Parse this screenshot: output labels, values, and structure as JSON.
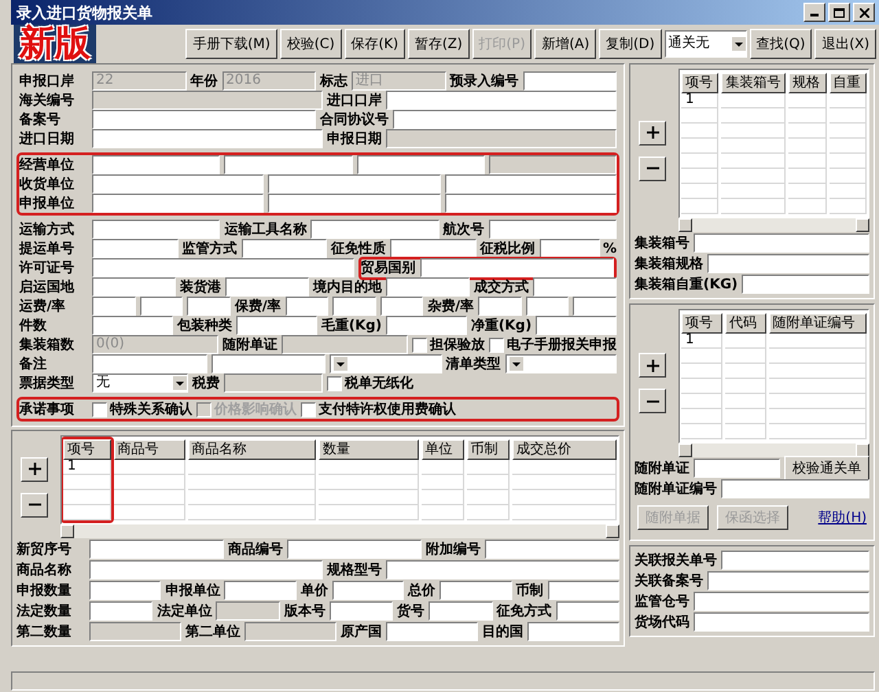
{
  "window": {
    "title": "录入进口货物报关单",
    "badge": "新版"
  },
  "toolbar": [
    {
      "kind": "button",
      "label": "手册下载(M)",
      "disabled": false
    },
    {
      "kind": "button",
      "label": "校验(C)",
      "disabled": false
    },
    {
      "kind": "button",
      "label": "保存(K)",
      "disabled": false
    },
    {
      "kind": "button",
      "label": "暂存(Z)",
      "disabled": false
    },
    {
      "kind": "button",
      "label": "打印(P)",
      "disabled": true
    },
    {
      "kind": "button",
      "label": "新增(A)",
      "disabled": false
    },
    {
      "kind": "button",
      "label": "复制(D)",
      "disabled": false
    },
    {
      "kind": "select",
      "value": "通关无"
    },
    {
      "kind": "button",
      "label": "查找(Q)",
      "disabled": false
    },
    {
      "kind": "button",
      "label": "退出(X)",
      "disabled": false
    }
  ],
  "form": {
    "sections": [
      {
        "highlight": false,
        "rows": [
          [
            {
              "kind": "label",
              "text": "申报口岸"
            },
            {
              "kind": "field",
              "value": "22",
              "disabled": true
            },
            {
              "kind": "label",
              "text": "年份"
            },
            {
              "kind": "field",
              "value": "2016",
              "disabled": true
            },
            {
              "kind": "label",
              "text": "标志"
            },
            {
              "kind": "field",
              "value": "进口",
              "disabled": true
            },
            {
              "kind": "label",
              "text": "预录入编号"
            },
            {
              "kind": "field",
              "disabled": false
            }
          ],
          [
            {
              "kind": "label",
              "text": "海关编号"
            },
            {
              "kind": "field",
              "disabled": true
            },
            {
              "kind": "label",
              "text": "进口口岸"
            },
            {
              "kind": "field",
              "disabled": false
            }
          ],
          [
            {
              "kind": "label",
              "text": "备案号"
            },
            {
              "kind": "field",
              "disabled": false
            },
            {
              "kind": "label",
              "text": "合同协议号"
            },
            {
              "kind": "field",
              "disabled": false
            }
          ],
          [
            {
              "kind": "label",
              "text": "进口日期"
            },
            {
              "kind": "field",
              "disabled": false
            },
            {
              "kind": "label",
              "text": "申报日期"
            },
            {
              "kind": "field",
              "disabled": true
            }
          ]
        ]
      },
      {
        "highlight": true,
        "rows": [
          [
            {
              "kind": "label",
              "text": "经营单位"
            },
            {
              "kind": "field",
              "disabled": false
            },
            {
              "kind": "field",
              "disabled": false
            },
            {
              "kind": "field",
              "disabled": false
            },
            {
              "kind": "field",
              "disabled": true
            }
          ],
          [
            {
              "kind": "label",
              "text": "收货单位"
            },
            {
              "kind": "field",
              "disabled": false
            },
            {
              "kind": "field",
              "disabled": false
            },
            {
              "kind": "field",
              "disabled": false
            }
          ],
          [
            {
              "kind": "label",
              "text": "申报单位"
            },
            {
              "kind": "field",
              "disabled": false
            },
            {
              "kind": "field",
              "disabled": false
            },
            {
              "kind": "field",
              "disabled": false
            }
          ]
        ]
      },
      {
        "highlight": false,
        "rows": [
          [
            {
              "kind": "label",
              "text": "运输方式"
            },
            {
              "kind": "field",
              "disabled": false
            },
            {
              "kind": "label",
              "text": "运输工具名称"
            },
            {
              "kind": "field",
              "disabled": false
            },
            {
              "kind": "label",
              "text": "航次号"
            },
            {
              "kind": "field",
              "disabled": false
            }
          ],
          [
            {
              "kind": "label",
              "text": "提运单号"
            },
            {
              "kind": "field",
              "disabled": false
            },
            {
              "kind": "label",
              "text": "监管方式"
            },
            {
              "kind": "field",
              "disabled": false
            },
            {
              "kind": "label",
              "text": "征免性质"
            },
            {
              "kind": "field",
              "disabled": false
            },
            {
              "kind": "label",
              "text": "征税比例"
            },
            {
              "kind": "field",
              "disabled": false,
              "suffix": "%"
            }
          ],
          [
            {
              "kind": "label",
              "text": "许可证号"
            },
            {
              "kind": "field",
              "disabled": false
            },
            {
              "kind": "group",
              "highlight": true,
              "cells": [
                {
                  "kind": "label",
                  "text": "贸易国别"
                },
                {
                  "kind": "field",
                  "disabled": false
                }
              ]
            }
          ],
          [
            {
              "kind": "label",
              "text": "启运国地"
            },
            {
              "kind": "field",
              "disabled": false
            },
            {
              "kind": "label",
              "text": "装货港"
            },
            {
              "kind": "field",
              "disabled": false
            },
            {
              "kind": "label",
              "text": "境内目的地"
            },
            {
              "kind": "field",
              "disabled": false
            },
            {
              "kind": "label",
              "text": "成交方式"
            },
            {
              "kind": "field",
              "disabled": false
            }
          ],
          [
            {
              "kind": "label",
              "text": "运费/率"
            },
            {
              "kind": "field",
              "disabled": false
            },
            {
              "kind": "field",
              "disabled": false
            },
            {
              "kind": "field",
              "disabled": false
            },
            {
              "kind": "label",
              "text": "保费/率"
            },
            {
              "kind": "field",
              "disabled": false
            },
            {
              "kind": "field",
              "disabled": false
            },
            {
              "kind": "field",
              "disabled": false
            },
            {
              "kind": "label",
              "text": "杂费/率"
            },
            {
              "kind": "field",
              "disabled": false
            },
            {
              "kind": "field",
              "disabled": false
            },
            {
              "kind": "field",
              "disabled": false
            }
          ],
          [
            {
              "kind": "label",
              "text": "件数"
            },
            {
              "kind": "field",
              "disabled": false
            },
            {
              "kind": "label",
              "text": "包装种类"
            },
            {
              "kind": "field",
              "disabled": false
            },
            {
              "kind": "label",
              "text": "毛重(Kg)"
            },
            {
              "kind": "field",
              "disabled": false
            },
            {
              "kind": "label",
              "text": "净重(Kg)"
            },
            {
              "kind": "field",
              "disabled": false
            }
          ],
          [
            {
              "kind": "label",
              "text": "集装箱数"
            },
            {
              "kind": "field",
              "value": "0(0)",
              "disabled": true
            },
            {
              "kind": "label",
              "text": "随附单证"
            },
            {
              "kind": "field",
              "disabled": true
            },
            {
              "kind": "check",
              "label": "担保验放",
              "checked": false,
              "disabled": false
            },
            {
              "kind": "check",
              "label": "电子手册报关申报",
              "checked": false,
              "disabled": false
            }
          ],
          [
            {
              "kind": "label",
              "text": "备注"
            },
            {
              "kind": "field",
              "disabled": false
            },
            {
              "kind": "field",
              "disabled": false
            },
            {
              "kind": "select"
            },
            {
              "kind": "label",
              "text": "清单类型"
            },
            {
              "kind": "select"
            }
          ],
          [
            {
              "kind": "label",
              "text": "票据类型"
            },
            {
              "kind": "select",
              "value": "无"
            },
            {
              "kind": "label",
              "text": "税费"
            },
            {
              "kind": "field",
              "disabled": true
            },
            {
              "kind": "check",
              "label": "税单无纸化",
              "checked": false,
              "disabled": false
            }
          ]
        ]
      },
      {
        "highlight": true,
        "rows": [
          [
            {
              "kind": "label",
              "text": "承诺事项"
            },
            {
              "kind": "check",
              "label": "特殊关系确认",
              "checked": false,
              "disabled": false
            },
            {
              "kind": "check",
              "label": "价格影响确认",
              "checked": false,
              "disabled": true
            },
            {
              "kind": "check",
              "label": "支付特许权使用费确认",
              "checked": false,
              "disabled": false
            }
          ]
        ]
      }
    ]
  },
  "goods": {
    "columns": [
      {
        "title": "项号",
        "highlight": true
      },
      {
        "title": "商品号",
        "highlight": false
      },
      {
        "title": "商品名称",
        "highlight": false
      },
      {
        "title": "数量",
        "highlight": false
      },
      {
        "title": "单位",
        "highlight": false
      },
      {
        "title": "币制",
        "highlight": false
      },
      {
        "title": "成交总价",
        "highlight": false
      }
    ],
    "rows": [
      [
        "1"
      ]
    ]
  },
  "item_form": {
    "rows": [
      [
        {
          "kind": "label",
          "text": "新贸序号"
        },
        {
          "kind": "field",
          "disabled": false
        },
        {
          "kind": "label",
          "text": "商品编号"
        },
        {
          "kind": "field",
          "disabled": false
        },
        {
          "kind": "label",
          "text": "附加编号"
        },
        {
          "kind": "field",
          "disabled": false
        }
      ],
      [
        {
          "kind": "label",
          "text": "商品名称"
        },
        {
          "kind": "field",
          "disabled": false
        },
        {
          "kind": "label",
          "text": "规格型号"
        },
        {
          "kind": "field",
          "disabled": false
        }
      ],
      [
        {
          "kind": "label",
          "text": "申报数量"
        },
        {
          "kind": "field",
          "disabled": false
        },
        {
          "kind": "label",
          "text": "申报单位"
        },
        {
          "kind": "field",
          "disabled": false
        },
        {
          "kind": "label",
          "text": "单价"
        },
        {
          "kind": "field",
          "disabled": false
        },
        {
          "kind": "label",
          "text": "总价"
        },
        {
          "kind": "field",
          "disabled": false
        },
        {
          "kind": "label",
          "text": "币制"
        },
        {
          "kind": "field",
          "disabled": false
        }
      ],
      [
        {
          "kind": "label",
          "text": "法定数量"
        },
        {
          "kind": "field",
          "disabled": false
        },
        {
          "kind": "label",
          "text": "法定单位"
        },
        {
          "kind": "field",
          "disabled": true
        },
        {
          "kind": "label",
          "text": "版本号"
        },
        {
          "kind": "field",
          "disabled": false
        },
        {
          "kind": "label",
          "text": "货号"
        },
        {
          "kind": "field",
          "disabled": false
        },
        {
          "kind": "label",
          "text": "征免方式"
        },
        {
          "kind": "field",
          "disabled": false
        }
      ],
      [
        {
          "kind": "label",
          "text": "第二数量"
        },
        {
          "kind": "field",
          "disabled": true
        },
        {
          "kind": "label",
          "text": "第二单位"
        },
        {
          "kind": "field",
          "disabled": true
        },
        {
          "kind": "label",
          "text": "原产国"
        },
        {
          "kind": "field",
          "disabled": false
        },
        {
          "kind": "label",
          "text": "目的国"
        },
        {
          "kind": "field",
          "disabled": false
        }
      ]
    ]
  },
  "containers": {
    "columns": [
      "项号",
      "集装箱号",
      "规格",
      "自重"
    ],
    "rows": [
      [
        "1"
      ]
    ],
    "fields": [
      [
        {
          "kind": "label",
          "text": "集装箱号"
        },
        {
          "kind": "field",
          "disabled": false
        }
      ],
      [
        {
          "kind": "label",
          "text": "集装箱规格"
        },
        {
          "kind": "field",
          "disabled": false
        }
      ],
      [
        {
          "kind": "label",
          "text": "集装箱自重(KG)"
        },
        {
          "kind": "field",
          "disabled": false
        }
      ]
    ]
  },
  "documents": {
    "columns": [
      "项号",
      "代码",
      "随附单证编号"
    ],
    "rows": [
      [
        "1"
      ]
    ],
    "fields": [
      [
        {
          "kind": "label",
          "text": "随附单证"
        },
        {
          "kind": "field",
          "disabled": false
        },
        {
          "kind": "button",
          "label": "校验通关单",
          "disabled": false
        }
      ],
      [
        {
          "kind": "label",
          "text": "随附单证编号"
        },
        {
          "kind": "field",
          "disabled": false
        }
      ]
    ],
    "buttons": [
      {
        "label": "随附单据",
        "disabled": true
      },
      {
        "label": "保函选择",
        "disabled": true
      }
    ],
    "help_link": "帮助(H)"
  },
  "related": {
    "fields": [
      [
        {
          "kind": "label",
          "text": "关联报关单号"
        },
        {
          "kind": "field",
          "disabled": false
        }
      ],
      [
        {
          "kind": "label",
          "text": "关联备案号"
        },
        {
          "kind": "field",
          "disabled": false
        }
      ],
      [
        {
          "kind": "label",
          "text": "监管仓号"
        },
        {
          "kind": "field",
          "disabled": false
        }
      ],
      [
        {
          "kind": "label",
          "text": "货场代码"
        },
        {
          "kind": "field",
          "disabled": false
        }
      ]
    ]
  }
}
